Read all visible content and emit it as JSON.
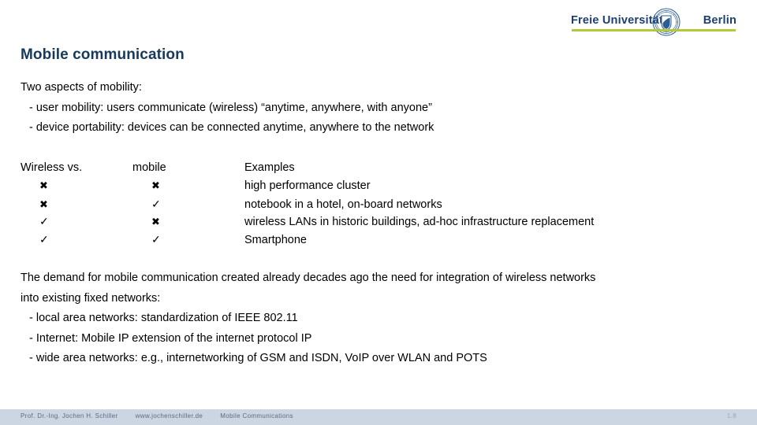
{
  "logo": {
    "word_left": "Freie Universität",
    "word_right": "Berlin",
    "seal_name": "fu-berlin-seal-icon",
    "accent_color": "#b4c93a",
    "text_color": "#1d3f6e"
  },
  "title": "Mobile communication",
  "title_color": "#17395c",
  "intro": {
    "heading": "Two aspects of mobility:",
    "lines": [
      "- user mobility: users communicate (wireless) “anytime, anywhere, with anyone”",
      "- device portability: devices can be connected anytime, anywhere to the network"
    ]
  },
  "comparison": {
    "headers": [
      "Wireless vs.",
      "mobile",
      "Examples"
    ],
    "rows": [
      {
        "wireless": "✖",
        "mobile": "✖",
        "example": "high performance cluster"
      },
      {
        "wireless": "✖",
        "mobile": "✓",
        "example": "notebook in a hotel, on-board networks"
      },
      {
        "wireless": "✓",
        "mobile": "✖",
        "example": "wireless LANs in historic buildings, ad-hoc infrastructure replacement"
      },
      {
        "wireless": "✓",
        "mobile": "✓",
        "example": "Smartphone"
      }
    ]
  },
  "demand": {
    "paragraph_line_1": "The demand for mobile communication created already decades ago the need for integration of wireless networks",
    "paragraph_line_2": "into existing fixed networks:",
    "bullets": [
      "- local area networks: standardization of IEEE 802.11",
      "- Internet: Mobile IP extension of the internet protocol IP",
      "- wide area networks: e.g., internetworking of GSM and ISDN, VoIP over WLAN and POTS"
    ]
  },
  "footer": {
    "author": "Prof. Dr.-Ing. Jochen H. Schiller",
    "website": "www.jochenschiller.de",
    "course": "Mobile Communications",
    "page": "1.8",
    "background_color": "#ccd5e2"
  }
}
